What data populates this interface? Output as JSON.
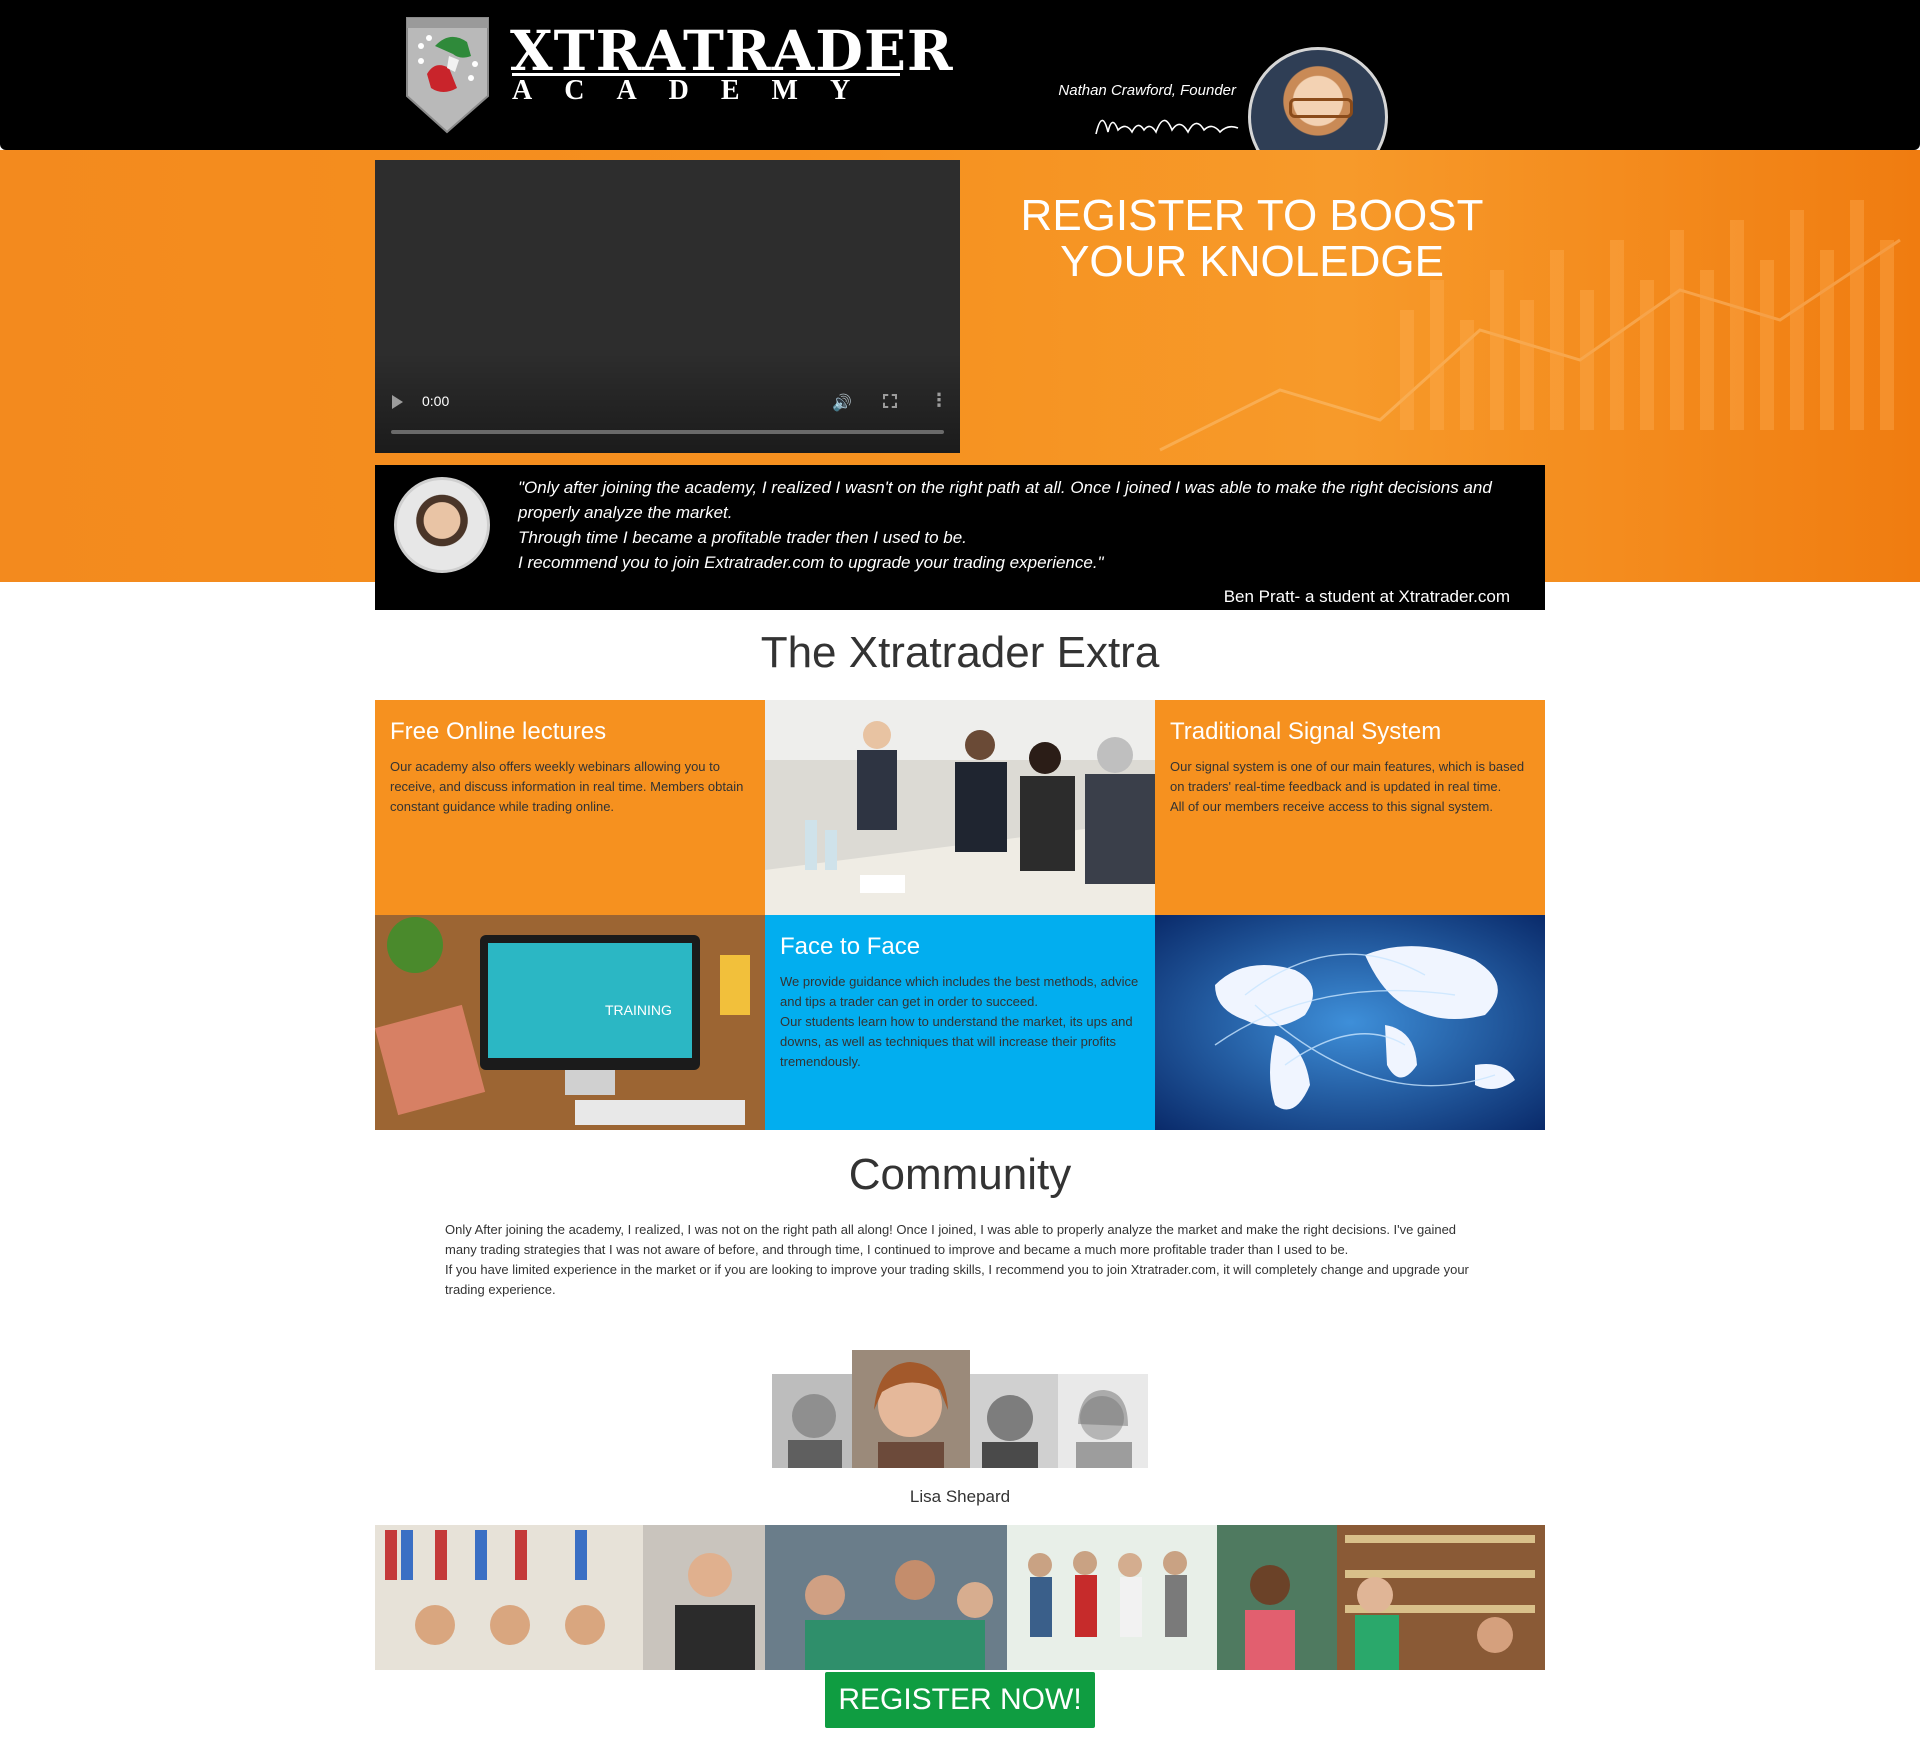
{
  "header": {
    "logo_title": "XTRATRADER",
    "logo_subtitle": "ACADEMY",
    "founder_name": "Nathan Crawford, Founder",
    "founder_signature": "NathanCrawford"
  },
  "hero": {
    "title_line1": "REGISTER TO BOOST",
    "title_line2": "YOUR KNOLEDGE",
    "video": {
      "time": "0:00",
      "play_icon": "play-icon",
      "volume_icon": "volume-icon",
      "fullscreen_icon": "fullscreen-icon",
      "more_icon": "more-vertical-icon"
    }
  },
  "testimonial": {
    "lines": [
      "\"Only after joining the academy, I realized I wasn't on the right path at all. Once I joined I was able to make the right decisions and properly analyze the market.",
      "Through time I became a profitable trader then I used to be.",
      "I recommend you to join Extratrader.com to upgrade your trading experience.\""
    ],
    "author": "Ben Pratt- a student at Xtratrader.com"
  },
  "extra": {
    "title": "The Xtratrader Extra",
    "tiles": [
      {
        "title": "Free Online lectures",
        "text": "Our academy also offers weekly webinars allowing you to receive, and discuss information in real time. Members obtain constant guidance while trading online."
      },
      {
        "title": "Traditional Signal System",
        "text": "Our signal system is one of our main features, which is based on traders' real-time feedback and is updated in real time.",
        "text2": "All of our members receive access to this signal system."
      },
      {
        "title": "Face to Face",
        "text": "We provide guidance which includes the best methods, advice and tips a trader can get in order to succeed.",
        "text2": "Our students learn how to understand the market, its ups and downs, as well as techniques that will increase their profits tremendously."
      }
    ]
  },
  "community": {
    "title": "Community",
    "paragraph1": "Only After joining the academy, I realized, I was not on the right path all along! Once I joined, I was able to properly analyze the market and make the right decisions. I've gained many trading strategies that I was not aware of before, and through time, I continued to improve and became a much more profitable trader than I used to be.",
    "paragraph2": "If you have limited experience in the market or if you are looking to improve your trading skills, I recommend you to join Xtratrader.com, it will completely change and upgrade your trading experience.",
    "selected_member": "Lisa Shepard"
  },
  "cta": {
    "label": "REGISTER NOW!"
  },
  "colors": {
    "orange": "#f6911f",
    "blue": "#02aeef",
    "green": "#0f9d41",
    "black": "#000000"
  }
}
